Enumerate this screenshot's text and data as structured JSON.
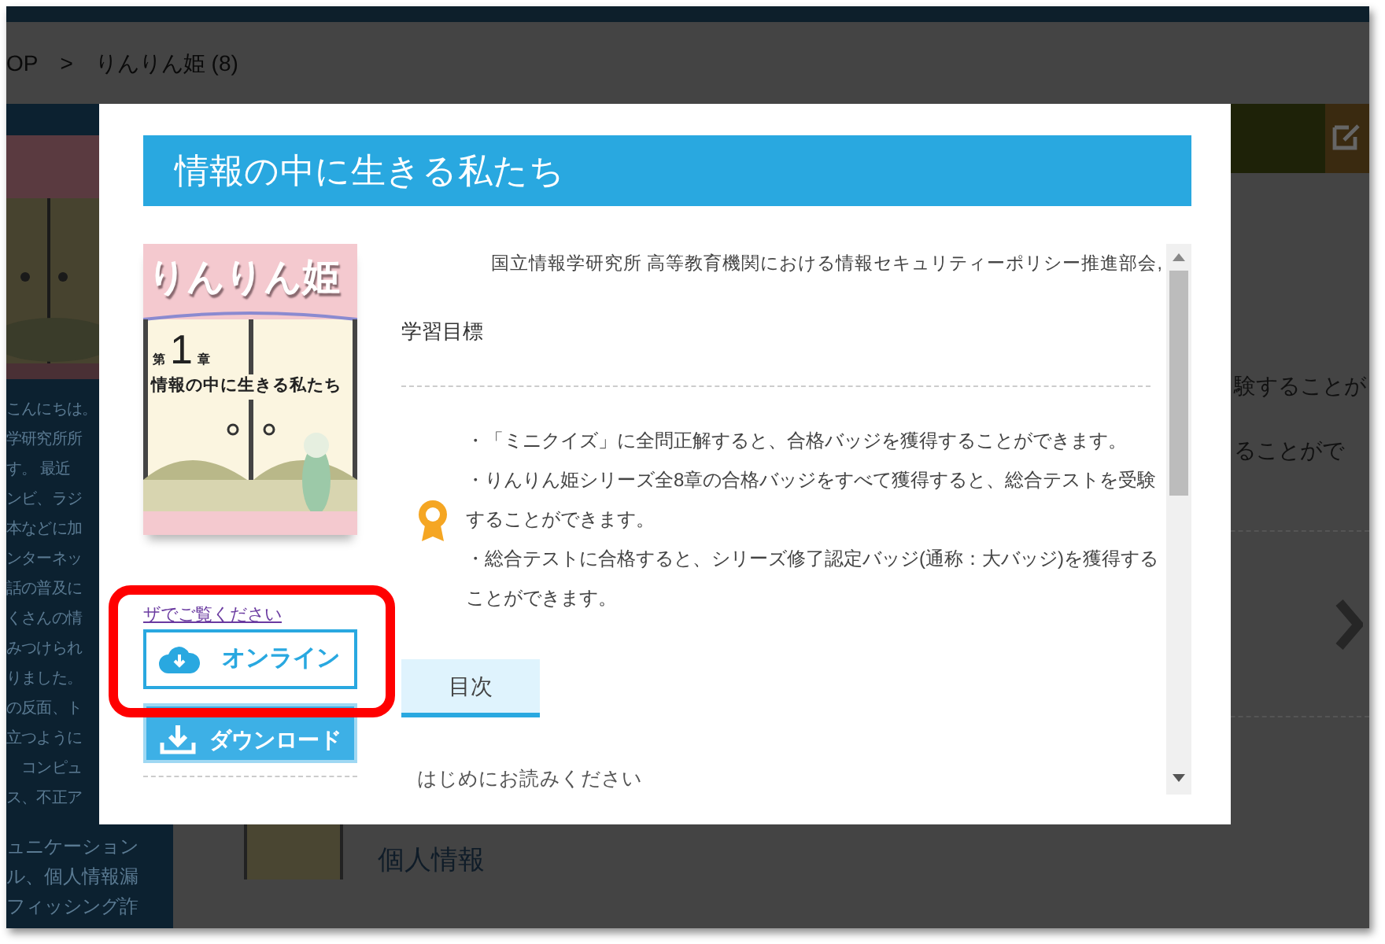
{
  "page": {
    "breadcrumb": [
      {
        "label": "OP"
      },
      {
        "label": "りんりん姫 (8)"
      }
    ],
    "separator": ">",
    "left_text": [
      "こんにちは。",
      "学研究所所",
      "す。 最近",
      "ンビ、ラジ",
      "本などに加",
      "ンターネッ",
      "話の普及に",
      "くさんの情",
      "みつけられ",
      "りました。",
      "の反面、ト",
      "立つように",
      "　コンピュ",
      "ス、不正ア"
    ],
    "left_text_below": [
      "ュニケーション",
      "ル、個人情報漏",
      "フィッシング詐"
    ],
    "right_text": [
      "験することが",
      "ることがで"
    ],
    "list_items": [
      {
        "title": "個人情報"
      }
    ]
  },
  "modal": {
    "title": "情報の中に生きる私たち",
    "cover": {
      "series": "りんりん姫",
      "chapter_prefix": "第",
      "chapter_number": "1",
      "chapter_suffix": "章",
      "chapter_title": "情報の中に生きる私たち"
    },
    "browser_note": "ザでご覧ください",
    "buttons": [
      {
        "label": "オンライン",
        "kind": "outline",
        "highlighted": true
      },
      {
        "label": "ダウンロード",
        "kind": "filled",
        "highlighted": false
      }
    ],
    "author": "国立情報学研究所 高等教育機関における情報セキュリティーポリシー推進部会,",
    "goal_heading": "学習目標",
    "goals": [
      "・「ミニクイズ」に全問正解すると、合格バッジを獲得することができます。",
      "・りんりん姫シリーズ全8章の合格バッジをすべて獲得すると、総合テストを受験することができます。",
      "・総合テストに合格すると、シリーズ修了認定バッジ(通称：大バッジ)を獲得することができます。"
    ],
    "tabs": [
      {
        "label": "目次",
        "selected": true
      }
    ],
    "toc": [
      "はじめにお読みください"
    ]
  }
}
